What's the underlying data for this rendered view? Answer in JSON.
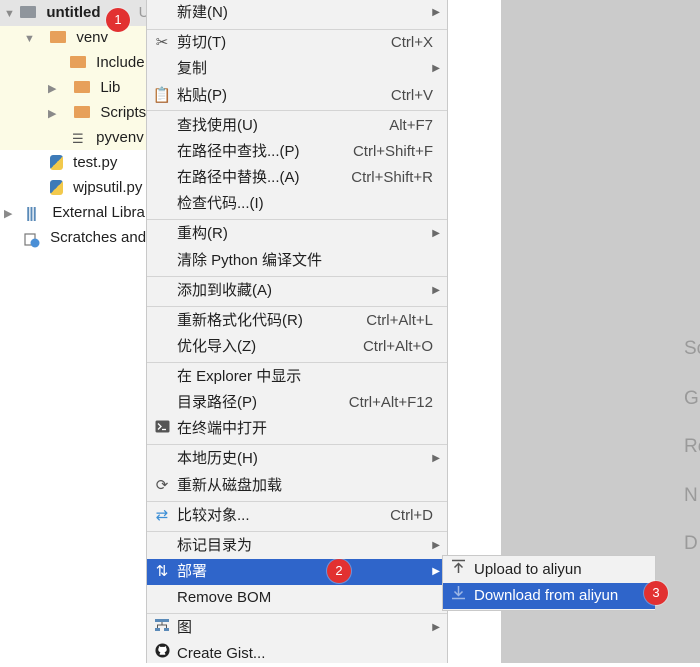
{
  "tree": {
    "root": {
      "label": "untitled",
      "suffix": "U"
    },
    "items": [
      {
        "label": "venv"
      },
      {
        "label": "Include"
      },
      {
        "label": "Lib"
      },
      {
        "label": "Scripts"
      },
      {
        "label": "pyvenv"
      },
      {
        "label": "test.py"
      },
      {
        "label": "wjpsutil.py"
      },
      {
        "label": "External Libra"
      },
      {
        "label": "Scratches and"
      }
    ]
  },
  "menu": {
    "items": [
      {
        "label": "新建(N)"
      },
      {
        "label": "剪切(T)",
        "shortcut": "Ctrl+X"
      },
      {
        "label": "复制"
      },
      {
        "label": "粘贴(P)",
        "shortcut": "Ctrl+V"
      },
      {
        "label": "查找使用(U)",
        "shortcut": "Alt+F7"
      },
      {
        "label": "在路径中查找...(P)",
        "shortcut": "Ctrl+Shift+F"
      },
      {
        "label": "在路径中替换...(A)",
        "shortcut": "Ctrl+Shift+R"
      },
      {
        "label": "检查代码...(I)"
      },
      {
        "label": "重构(R)"
      },
      {
        "label": "清除 Python 编译文件"
      },
      {
        "label": "添加到收藏(A)"
      },
      {
        "label": "重新格式化代码(R)",
        "shortcut": "Ctrl+Alt+L"
      },
      {
        "label": "优化导入(Z)",
        "shortcut": "Ctrl+Alt+O"
      },
      {
        "label": "在 Explorer 中显示"
      },
      {
        "label": "目录路径(P)",
        "shortcut": "Ctrl+Alt+F12"
      },
      {
        "label": "在终端中打开"
      },
      {
        "label": "本地历史(H)"
      },
      {
        "label": "重新从磁盘加载"
      },
      {
        "label": "比较对象...",
        "shortcut": "Ctrl+D"
      },
      {
        "label": "标记目录为"
      },
      {
        "label": "部署"
      },
      {
        "label": "Remove BOM"
      },
      {
        "label": "图"
      },
      {
        "label": "Create Gist..."
      }
    ]
  },
  "submenu": {
    "items": [
      {
        "label": "Upload to aliyun"
      },
      {
        "label": "Download from aliyun"
      }
    ]
  },
  "right_letters": [
    "Sc",
    "G",
    "Re",
    "N",
    "D"
  ],
  "badges": [
    "1",
    "2",
    "3"
  ],
  "colors": {
    "selection": "#2f65ca",
    "badge": "#e23131",
    "folder": "#e7a05a"
  }
}
